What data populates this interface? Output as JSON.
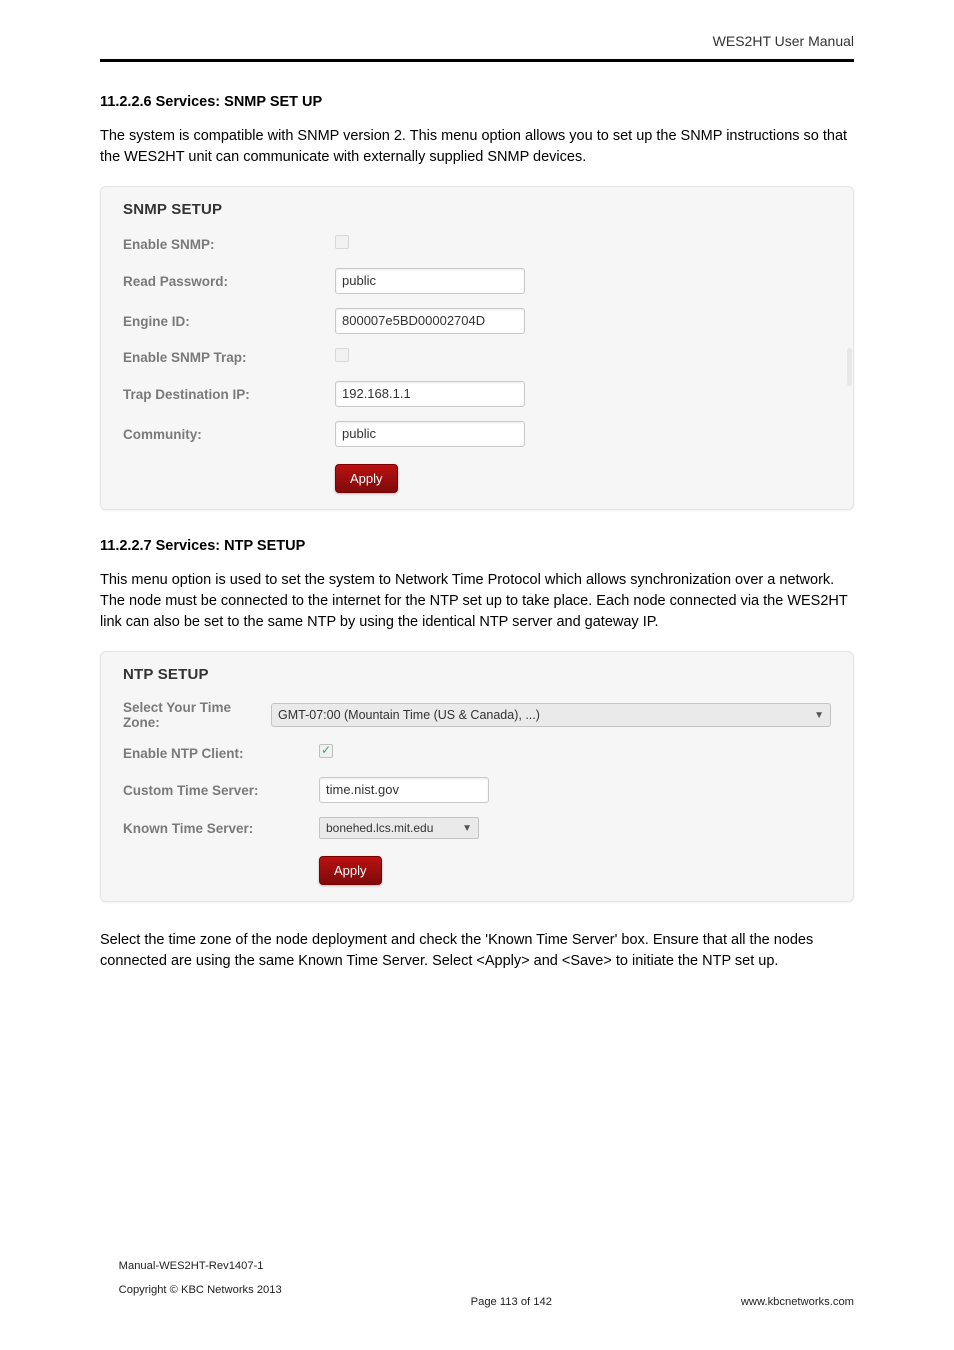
{
  "header": {
    "right": "WES2HT User Manual"
  },
  "section1": {
    "title": "11.2.2.6 Services: SNMP SET UP",
    "para": "The system is compatible with SNMP version 2. This menu option allows you to set up the SNMP instructions so that the WES2HT unit can communicate with externally supplied SNMP devices."
  },
  "snmp": {
    "panel_title": "SNMP SETUP",
    "enable_snmp_label": "Enable SNMP:",
    "read_password_label": "Read Password:",
    "read_password_value": "public",
    "engine_id_label": "Engine ID:",
    "engine_id_value": "800007e5BD00002704D",
    "enable_trap_label": "Enable SNMP Trap:",
    "trap_ip_label": "Trap Destination IP:",
    "trap_ip_value": "192.168.1.1",
    "community_label": "Community:",
    "community_value": "public",
    "apply_label": "Apply"
  },
  "section2": {
    "title": "11.2.2.7 Services: NTP SETUP",
    "para": "This menu option is used to set the system to Network Time Protocol which allows synchronization over a network. The node must be connected to the internet for the NTP set up to take place. Each node connected via the WES2HT link can also be set to the same NTP by using the identical NTP server and gateway IP."
  },
  "ntp": {
    "panel_title": "NTP SETUP",
    "tz_label": "Select Your Time Zone:",
    "tz_value": "GMT-07:00 (Mountain Time (US & Canada), ...)",
    "enable_client_label": "Enable NTP Client:",
    "custom_server_label": "Custom Time Server:",
    "custom_server_value": "time.nist.gov",
    "known_server_label": "Known Time Server:",
    "known_server_value": "bonehed.lcs.mit.edu",
    "apply_label": "Apply"
  },
  "para3": "Select the time zone of the node deployment and check the 'Known Time Server' box. Ensure that all the nodes connected are using the same Known Time Server. Select <Apply> and <Save> to initiate the NTP set up.",
  "footer": {
    "left1": "Manual-WES2HT-Rev1407-1",
    "left2": "Copyright © KBC Networks 2013",
    "center": "Page 113 of 142",
    "right": "www.kbcnetworks.com"
  }
}
